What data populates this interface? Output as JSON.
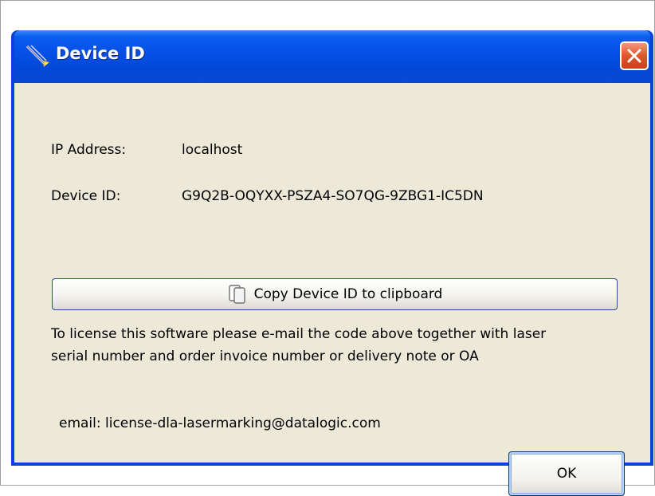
{
  "window": {
    "title": "Device ID"
  },
  "fields": {
    "ip_label": "IP Address:",
    "ip_value": "localhost",
    "device_label": "Device ID:",
    "device_value": "G9Q2B-OQYXX-PSZA4-SO7QG-9ZBG1-IC5DN"
  },
  "buttons": {
    "copy_label": "Copy Device ID to clipboard",
    "ok_label": "OK"
  },
  "message": {
    "line1": "To license this software please e-mail the code above together with laser",
    "line2": "serial number and order invoice number or delivery note or OA"
  },
  "email": {
    "text": "email: license-dla-lasermarking@datalogic.com"
  },
  "icons": {
    "title": "laser-app-icon",
    "close": "close-icon",
    "copy": "clipboard-icon"
  },
  "colors": {
    "titlebar": "#0550e6",
    "window_border": "#0a43d8",
    "client_bg": "#ece9d8",
    "close_button": "#e05a30"
  }
}
